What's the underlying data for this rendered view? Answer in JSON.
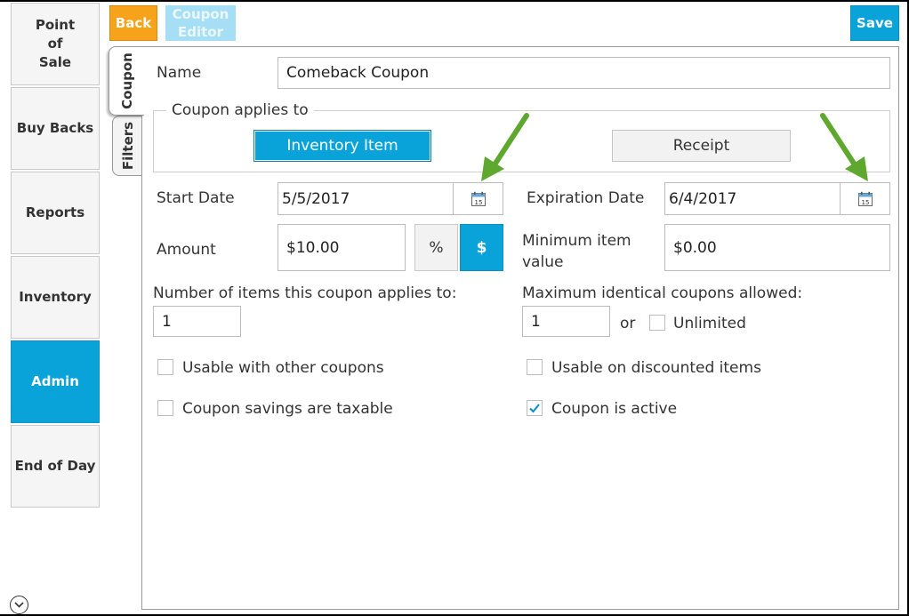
{
  "sidebar": {
    "items": [
      {
        "label": "Point\nof\nSale",
        "active": false
      },
      {
        "label": "Buy Backs",
        "active": false
      },
      {
        "label": "Reports",
        "active": false
      },
      {
        "label": "Inventory",
        "active": false
      },
      {
        "label": "Admin",
        "active": true
      },
      {
        "label": "End of Day",
        "active": false
      }
    ],
    "bottom_icon": "chevron-down-circle-icon"
  },
  "toolbar": {
    "back_label": "Back",
    "editor_label": "Coupon\nEditor",
    "save_label": "Save"
  },
  "tabs": [
    {
      "label": "Coupon",
      "selected": true
    },
    {
      "label": "Filters",
      "selected": false
    }
  ],
  "form": {
    "name_label": "Name",
    "name_value": "Comeback Coupon",
    "applies_to": {
      "legend": "Coupon applies to",
      "options": [
        "Inventory Item",
        "Receipt"
      ],
      "selected": "Inventory Item"
    },
    "start_date_label": "Start Date",
    "start_date_value": "5/5/2017",
    "expiration_date_label": "Expiration Date",
    "expiration_date_value": "6/4/2017",
    "calendar_day": "15",
    "amount_label": "Amount",
    "amount_value": "$10.00",
    "percent_label": "%",
    "dollar_label": "$",
    "amount_mode": "$",
    "min_item_label": "Minimum item\nvalue",
    "min_item_value": "$0.00",
    "num_items_label": "Number of items this coupon applies to:",
    "num_items_value": "1",
    "max_identical_label": "Maximum identical coupons allowed:",
    "max_identical_value": "1",
    "or_label": "or",
    "unlimited_label": "Unlimited",
    "unlimited_checked": false,
    "checkboxes": [
      {
        "label": "Usable with other coupons",
        "checked": false
      },
      {
        "label": "Usable on discounted items",
        "checked": false
      },
      {
        "label": "Coupon savings are taxable",
        "checked": false
      },
      {
        "label": "Coupon is active",
        "checked": true
      }
    ]
  },
  "colors": {
    "accent": "#0aa3d9",
    "back": "#f7a21b",
    "editor": "#a6dff5",
    "arrow": "#5fa830"
  }
}
